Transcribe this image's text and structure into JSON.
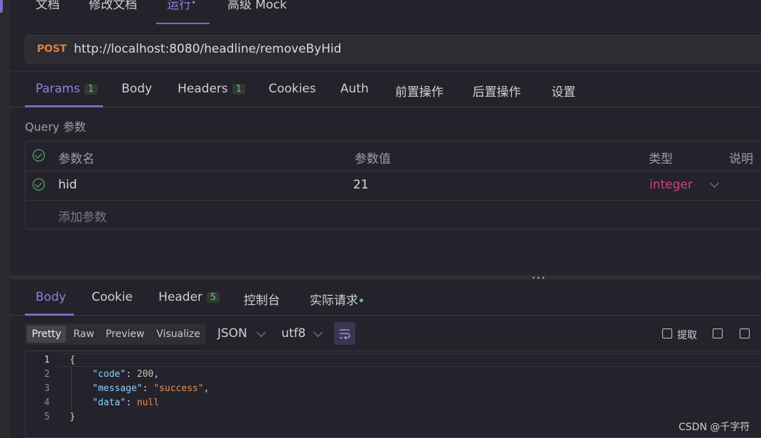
{
  "top_tabs": [
    {
      "label": "文档"
    },
    {
      "label": "修改文档"
    },
    {
      "label": "运行"
    },
    {
      "label": "高级 Mock"
    }
  ],
  "active_top_tab_dot": "•",
  "request": {
    "method": "POST",
    "url": "http://localhost:8080/headline/removeByHid"
  },
  "request_tabs": [
    {
      "label": "Params",
      "badge": "1"
    },
    {
      "label": "Body"
    },
    {
      "label": "Headers",
      "badge": "1"
    },
    {
      "label": "Cookies"
    },
    {
      "label": "Auth"
    },
    {
      "label": "前置操作"
    },
    {
      "label": "后置操作"
    },
    {
      "label": "设置"
    }
  ],
  "query": {
    "section_label": "Query 参数",
    "columns": {
      "name": "参数名",
      "value": "参数值",
      "type": "类型",
      "desc": "说明"
    },
    "rows": [
      {
        "name": "hid",
        "value": "21",
        "type": "integer"
      }
    ],
    "add_placeholder": "添加参数"
  },
  "response_tabs": [
    {
      "label": "Body"
    },
    {
      "label": "Cookie"
    },
    {
      "label": "Header",
      "badge": "5"
    },
    {
      "label": "控制台"
    },
    {
      "label": "实际请求"
    }
  ],
  "response_toolbar": {
    "view_modes": [
      "Pretty",
      "Raw",
      "Preview",
      "Visualize"
    ],
    "active_view_mode": "Pretty",
    "format": "JSON",
    "encoding": "utf8",
    "extract_label": "提取",
    "icons": [
      "wrap-lines-icon",
      "extract-icon",
      "download-icon",
      "copy-icon"
    ]
  },
  "response_body": {
    "line_numbers": [
      "1",
      "2",
      "3",
      "4",
      "5"
    ],
    "open_brace": "{",
    "close_brace": "}",
    "fields": [
      {
        "key": "\"code\"",
        "colon": ": ",
        "value": "200",
        "comma": ","
      },
      {
        "key": "\"message\"",
        "colon": ": ",
        "value": "\"success\"",
        "comma": ","
      },
      {
        "key": "\"data\"",
        "colon": ": ",
        "value": "null",
        "comma": ""
      }
    ]
  },
  "watermark": "CSDN @千字符",
  "colors": {
    "accent": "#7a6bc9",
    "method_post": "#e0803a",
    "type_text": "#d0448a",
    "badge_green": "#6fbf7a"
  }
}
